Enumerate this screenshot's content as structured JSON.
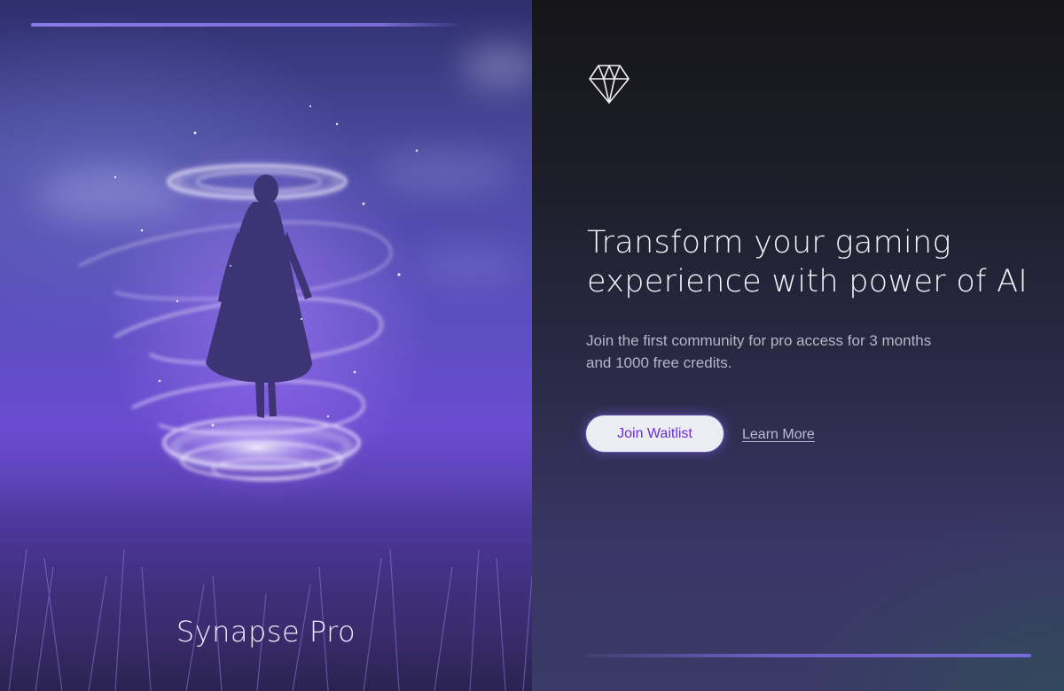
{
  "hero": {
    "title": "Synapse Pro",
    "image_description_icon": "levitating-figure-illustration"
  },
  "content": {
    "logo_icon": "diamond-icon",
    "headline": "Transform your gaming experience with power of AI",
    "subtext": "Join the first community for pro access for 3 months and 1000 free credits.",
    "primary_button_label": "Join Waitlist",
    "secondary_link_label": "Learn More"
  },
  "colors": {
    "accent": "#6b2fd6",
    "hero_purple": "#6a4bd0",
    "panel_dark": "#151519",
    "line_accent": "#7a6cd8"
  }
}
